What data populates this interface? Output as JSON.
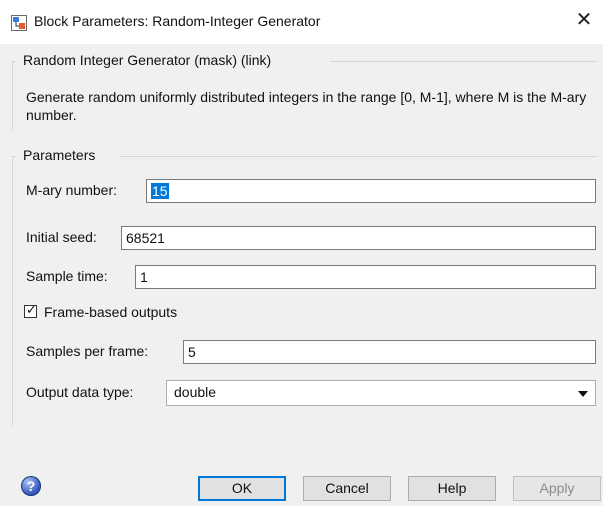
{
  "window": {
    "title": "Block Parameters: Random-Integer Generator",
    "close_glyph": "✕"
  },
  "mask_group": {
    "label": "Random Integer Generator (mask) (link)",
    "description": "Generate random uniformly distributed integers in the range [0, M-1], where M is the M-ary number."
  },
  "parameters_group": {
    "label": "Parameters",
    "mary": {
      "label": "M-ary number:",
      "value": "15"
    },
    "seed": {
      "label": "Initial seed:",
      "value": "68521"
    },
    "sample_time": {
      "label": "Sample time:",
      "value": "1"
    },
    "frame_based": {
      "label": "Frame-based outputs",
      "checked": true,
      "glyph": "✓"
    },
    "samples_per_frame": {
      "label": "Samples per frame:",
      "value": "5"
    },
    "output_type": {
      "label": "Output data type:",
      "value": "double"
    }
  },
  "buttons": {
    "ok": "OK",
    "cancel": "Cancel",
    "help": "Help",
    "apply": "Apply",
    "help_icon_glyph": "?"
  },
  "icons": {
    "app": "simulink-block-icon",
    "close": "close-icon",
    "help": "help-icon",
    "dropdown": "chevron-down-icon",
    "checkbox": "checkbox-icon"
  },
  "colors": {
    "selection": "#0078d7",
    "primary_border": "#0078d7"
  }
}
